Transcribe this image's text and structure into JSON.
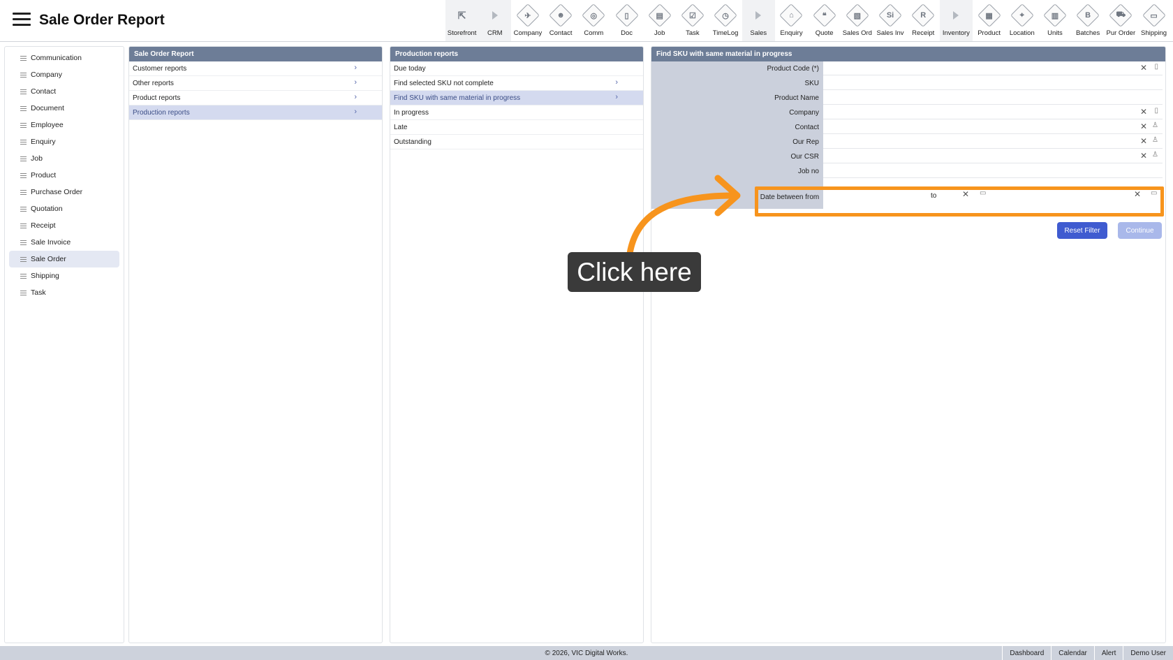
{
  "header": {
    "title": "Sale Order Report"
  },
  "toolbar": {
    "items": [
      {
        "label": "Storefront",
        "glyph": "⇱",
        "style": "plain"
      },
      {
        "label": "CRM",
        "glyph": "",
        "style": "arrow"
      },
      {
        "label": "Company",
        "glyph": "✈",
        "style": "diamond"
      },
      {
        "label": "Contact",
        "glyph": "☻",
        "style": "diamond"
      },
      {
        "label": "Comm",
        "glyph": "◎",
        "style": "diamond"
      },
      {
        "label": "Doc",
        "glyph": "▯",
        "style": "diamond"
      },
      {
        "label": "Job",
        "glyph": "▤",
        "style": "diamond"
      },
      {
        "label": "Task",
        "glyph": "☑",
        "style": "diamond"
      },
      {
        "label": "TimeLog",
        "glyph": "◷",
        "style": "diamond"
      },
      {
        "label": "Sales",
        "glyph": "",
        "style": "arrow"
      },
      {
        "label": "Enquiry",
        "glyph": "⌂",
        "style": "diamond"
      },
      {
        "label": "Quote",
        "glyph": "❝",
        "style": "diamond"
      },
      {
        "label": "Sales Ord",
        "glyph": "▧",
        "style": "diamond"
      },
      {
        "label": "Sales Inv",
        "glyph": "Si",
        "style": "diamond"
      },
      {
        "label": "Receipt",
        "glyph": "R",
        "style": "diamond"
      },
      {
        "label": "Inventory",
        "glyph": "",
        "style": "arrow"
      },
      {
        "label": "Product",
        "glyph": "▦",
        "style": "diamond"
      },
      {
        "label": "Location",
        "glyph": "⌖",
        "style": "diamond"
      },
      {
        "label": "Units",
        "glyph": "▥",
        "style": "diamond"
      },
      {
        "label": "Batches",
        "glyph": "B",
        "style": "diamond"
      },
      {
        "label": "Pur Order",
        "glyph": "⛟",
        "style": "diamond"
      },
      {
        "label": "Shipping",
        "glyph": "▭",
        "style": "diamond"
      }
    ]
  },
  "sidebar": {
    "items": [
      {
        "label": "Communication"
      },
      {
        "label": "Company"
      },
      {
        "label": "Contact"
      },
      {
        "label": "Document"
      },
      {
        "label": "Employee"
      },
      {
        "label": "Enquiry"
      },
      {
        "label": "Job"
      },
      {
        "label": "Product"
      },
      {
        "label": "Purchase Order"
      },
      {
        "label": "Quotation"
      },
      {
        "label": "Receipt"
      },
      {
        "label": "Sale Invoice"
      },
      {
        "label": "Sale Order"
      },
      {
        "label": "Shipping"
      },
      {
        "label": "Task"
      }
    ],
    "active_index": 12
  },
  "report_panel": {
    "title": "Sale Order Report",
    "items": [
      {
        "label": "Customer reports"
      },
      {
        "label": "Other reports"
      },
      {
        "label": "Product reports"
      },
      {
        "label": "Production reports"
      }
    ],
    "active_index": 3
  },
  "production_panel": {
    "title": "Production reports",
    "items": [
      {
        "label": "Due today",
        "chevron": false
      },
      {
        "label": "Find selected SKU not complete",
        "chevron": true
      },
      {
        "label": "Find SKU with same material in progress",
        "chevron": true
      },
      {
        "label": "In progress",
        "chevron": false
      },
      {
        "label": "Late",
        "chevron": false
      },
      {
        "label": "Outstanding",
        "chevron": false
      }
    ],
    "active_index": 2
  },
  "form": {
    "title": "Find SKU with same material in progress",
    "fields": [
      {
        "label": "Product Code (*)",
        "value": "",
        "clear": true,
        "icon": "▯"
      },
      {
        "label": "SKU",
        "value": "",
        "clear": false,
        "icon": ""
      },
      {
        "label": "Product Name",
        "value": "",
        "clear": false,
        "icon": ""
      },
      {
        "label": "Company",
        "value": "",
        "clear": true,
        "icon": "▯"
      },
      {
        "label": "Contact",
        "value": "",
        "clear": true,
        "icon": "♙"
      },
      {
        "label": "Our Rep",
        "value": "",
        "clear": true,
        "icon": "♙"
      },
      {
        "label": "Our CSR",
        "value": "",
        "clear": true,
        "icon": "♙"
      },
      {
        "label": "Job no",
        "value": "",
        "clear": false,
        "icon": ""
      }
    ],
    "date_label": "Date between from",
    "date_from": "",
    "date_to_label": "to",
    "date_to": "",
    "reset_label": "Reset Filter",
    "continue_label": "Continue"
  },
  "callout": {
    "text": "Click here",
    "accent": "#f7941d"
  },
  "footer": {
    "copyright": "© 2026, VIC Digital Works.",
    "links": [
      "Dashboard",
      "Calendar",
      "Alert",
      "Demo User"
    ]
  }
}
